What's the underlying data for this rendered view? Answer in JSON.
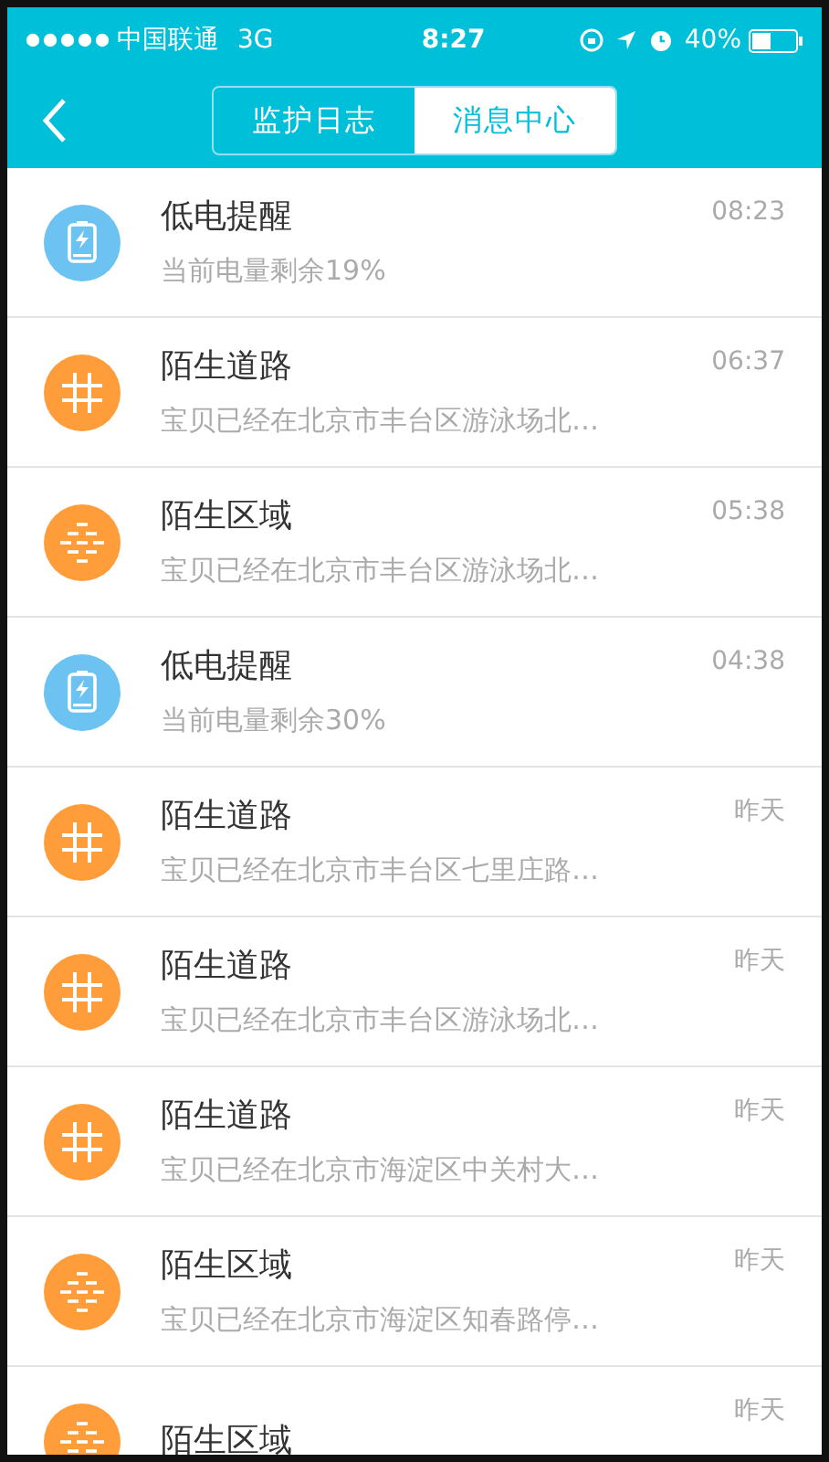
{
  "status_bar": {
    "carrier": "中国联通",
    "network": "3G",
    "time": "8:27",
    "battery": "40%"
  },
  "nav": {
    "tabs": [
      {
        "label": "监护日志",
        "selected": false
      },
      {
        "label": "消息中心",
        "selected": true
      }
    ]
  },
  "messages": [
    {
      "kind": "battery",
      "title": "低电提醒",
      "subtitle": "当前电量剩余19%",
      "time": "08:23"
    },
    {
      "kind": "road",
      "title": "陌生道路",
      "subtitle": "宝贝已经在北京市丰台区游泳场北…",
      "time": "06:37"
    },
    {
      "kind": "area",
      "title": "陌生区域",
      "subtitle": "宝贝已经在北京市丰台区游泳场北…",
      "time": "05:38"
    },
    {
      "kind": "battery",
      "title": "低电提醒",
      "subtitle": "当前电量剩余30%",
      "time": "04:38"
    },
    {
      "kind": "road",
      "title": "陌生道路",
      "subtitle": "宝贝已经在北京市丰台区七里庄路…",
      "time": "昨天"
    },
    {
      "kind": "road",
      "title": "陌生道路",
      "subtitle": "宝贝已经在北京市丰台区游泳场北…",
      "time": "昨天"
    },
    {
      "kind": "road",
      "title": "陌生道路",
      "subtitle": "宝贝已经在北京市海淀区中关村大…",
      "time": "昨天"
    },
    {
      "kind": "area",
      "title": "陌生区域",
      "subtitle": "宝贝已经在北京市海淀区知春路停…",
      "time": "昨天"
    },
    {
      "kind": "area",
      "title": "陌生区域",
      "time": "昨天"
    }
  ]
}
